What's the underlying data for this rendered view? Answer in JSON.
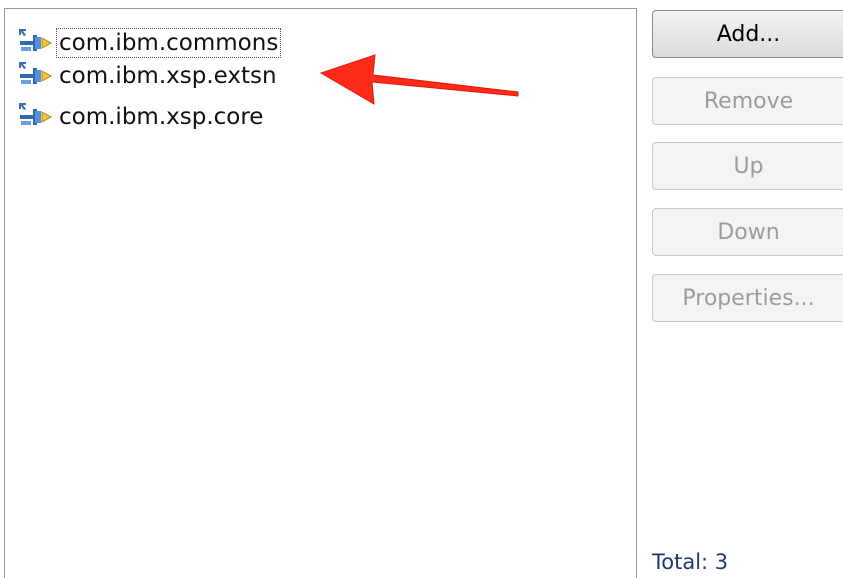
{
  "list": {
    "items": [
      {
        "label": "com.ibm.commons",
        "icon": "plugin-icon"
      },
      {
        "label": "com.ibm.xsp.extsn",
        "icon": "plugin-icon"
      },
      {
        "label": "com.ibm.xsp.core",
        "icon": "plugin-icon"
      }
    ]
  },
  "buttons": {
    "add": "Add...",
    "remove": "Remove",
    "up": "Up",
    "down": "Down",
    "properties": "Properties..."
  },
  "status": {
    "total": "Total: 3"
  },
  "annotation": {
    "icon": "red-arrow-icon",
    "color": "#ff2a1a"
  }
}
